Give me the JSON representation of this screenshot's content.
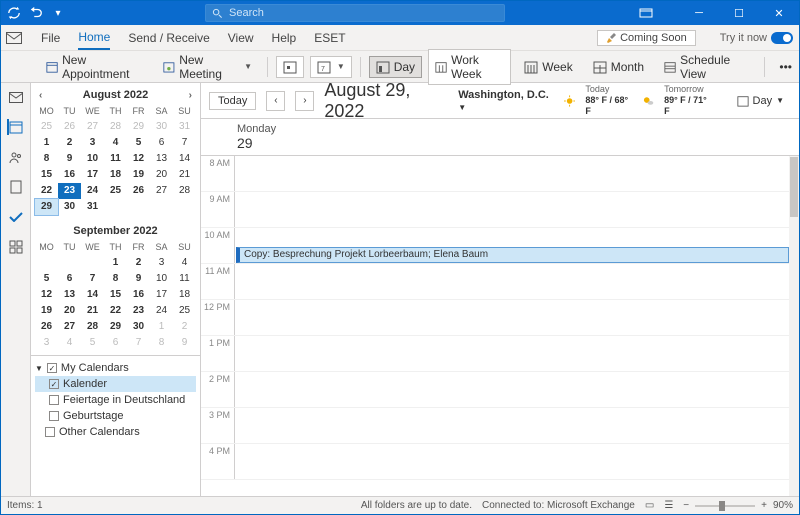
{
  "titlebar": {
    "search_placeholder": "Search"
  },
  "menubar": {
    "file": "File",
    "home": "Home",
    "send_receive": "Send / Receive",
    "view": "View",
    "help": "Help",
    "eset": "ESET",
    "coming_soon": "Coming Soon",
    "try_it": "Try it now"
  },
  "toolbar": {
    "new_appointment": "New Appointment",
    "new_meeting": "New Meeting",
    "day": "Day",
    "work_week": "Work Week",
    "week": "Week",
    "month": "Month",
    "schedule_view": "Schedule View"
  },
  "minicals": [
    {
      "title": "August 2022",
      "dow": [
        "MO",
        "TU",
        "WE",
        "TH",
        "FR",
        "SA",
        "SU"
      ],
      "rows": [
        [
          {
            "d": "25",
            "o": true
          },
          {
            "d": "26",
            "o": true
          },
          {
            "d": "27",
            "o": true
          },
          {
            "d": "28",
            "o": true
          },
          {
            "d": "29",
            "o": true
          },
          {
            "d": "30",
            "o": true
          },
          {
            "d": "31",
            "o": true
          }
        ],
        [
          {
            "d": "1",
            "b": true
          },
          {
            "d": "2",
            "b": true
          },
          {
            "d": "3",
            "b": true
          },
          {
            "d": "4",
            "b": true
          },
          {
            "d": "5",
            "b": true
          },
          {
            "d": "6"
          },
          {
            "d": "7"
          }
        ],
        [
          {
            "d": "8",
            "b": true
          },
          {
            "d": "9",
            "b": true
          },
          {
            "d": "10",
            "b": true
          },
          {
            "d": "11",
            "b": true
          },
          {
            "d": "12",
            "b": true
          },
          {
            "d": "13"
          },
          {
            "d": "14"
          }
        ],
        [
          {
            "d": "15",
            "b": true
          },
          {
            "d": "16",
            "b": true
          },
          {
            "d": "17",
            "b": true
          },
          {
            "d": "18",
            "b": true
          },
          {
            "d": "19",
            "b": true
          },
          {
            "d": "20"
          },
          {
            "d": "21"
          }
        ],
        [
          {
            "d": "22",
            "b": true
          },
          {
            "d": "23",
            "today": true
          },
          {
            "d": "24",
            "b": true
          },
          {
            "d": "25",
            "b": true
          },
          {
            "d": "26",
            "b": true
          },
          {
            "d": "27"
          },
          {
            "d": "28"
          }
        ],
        [
          {
            "d": "29",
            "sel": true
          },
          {
            "d": "30",
            "b": true
          },
          {
            "d": "31",
            "b": true
          },
          {
            "d": ""
          },
          {
            "d": ""
          },
          {
            "d": ""
          },
          {
            "d": ""
          }
        ]
      ]
    },
    {
      "title": "September 2022",
      "dow": [
        "MO",
        "TU",
        "WE",
        "TH",
        "FR",
        "SA",
        "SU"
      ],
      "rows": [
        [
          {
            "d": ""
          },
          {
            "d": ""
          },
          {
            "d": ""
          },
          {
            "d": "1",
            "b": true
          },
          {
            "d": "2",
            "b": true
          },
          {
            "d": "3"
          },
          {
            "d": "4"
          }
        ],
        [
          {
            "d": "5",
            "b": true
          },
          {
            "d": "6",
            "b": true
          },
          {
            "d": "7",
            "b": true
          },
          {
            "d": "8",
            "b": true
          },
          {
            "d": "9",
            "b": true
          },
          {
            "d": "10"
          },
          {
            "d": "11"
          }
        ],
        [
          {
            "d": "12",
            "b": true
          },
          {
            "d": "13",
            "b": true
          },
          {
            "d": "14",
            "b": true
          },
          {
            "d": "15",
            "b": true
          },
          {
            "d": "16",
            "b": true
          },
          {
            "d": "17"
          },
          {
            "d": "18"
          }
        ],
        [
          {
            "d": "19",
            "b": true
          },
          {
            "d": "20",
            "b": true
          },
          {
            "d": "21",
            "b": true
          },
          {
            "d": "22",
            "b": true
          },
          {
            "d": "23",
            "b": true
          },
          {
            "d": "24"
          },
          {
            "d": "25"
          }
        ],
        [
          {
            "d": "26",
            "b": true
          },
          {
            "d": "27",
            "b": true
          },
          {
            "d": "28",
            "b": true
          },
          {
            "d": "29",
            "b": true
          },
          {
            "d": "30",
            "b": true
          },
          {
            "d": "1",
            "o": true
          },
          {
            "d": "2",
            "o": true
          }
        ],
        [
          {
            "d": "3",
            "o": true
          },
          {
            "d": "4",
            "o": true
          },
          {
            "d": "5",
            "o": true
          },
          {
            "d": "6",
            "o": true
          },
          {
            "d": "7",
            "o": true
          },
          {
            "d": "8",
            "o": true
          },
          {
            "d": "9",
            "o": true
          }
        ]
      ]
    }
  ],
  "calendars": {
    "my": "My Calendars",
    "items": [
      {
        "label": "Kalender",
        "checked": true,
        "selected": true
      },
      {
        "label": "Feiertage in Deutschland",
        "checked": false
      },
      {
        "label": "Geburtstage",
        "checked": false
      }
    ],
    "other": "Other Calendars"
  },
  "datebar": {
    "today": "Today",
    "title": "August 29, 2022",
    "location": "Washington,  D.C.",
    "wx1_label": "Today",
    "wx1_temp": "88° F / 68° F",
    "wx2_label": "Tomorrow",
    "wx2_temp": "89° F / 71° F",
    "day_label": "Day"
  },
  "dayhead": {
    "dow": "Monday",
    "dnum": "29"
  },
  "hours": [
    "8 AM",
    "9 AM",
    "10 AM",
    "11 AM",
    "12 PM",
    "1 PM",
    "2 PM",
    "3 PM",
    "4 PM"
  ],
  "appointment": {
    "text": "Copy: Besprechung Projekt Lorbeerbaum; Elena Baum"
  },
  "status": {
    "items": "Items: 1",
    "uptodate": "All folders are up to date.",
    "connected": "Connected to: Microsoft Exchange",
    "zoom": "90%"
  }
}
